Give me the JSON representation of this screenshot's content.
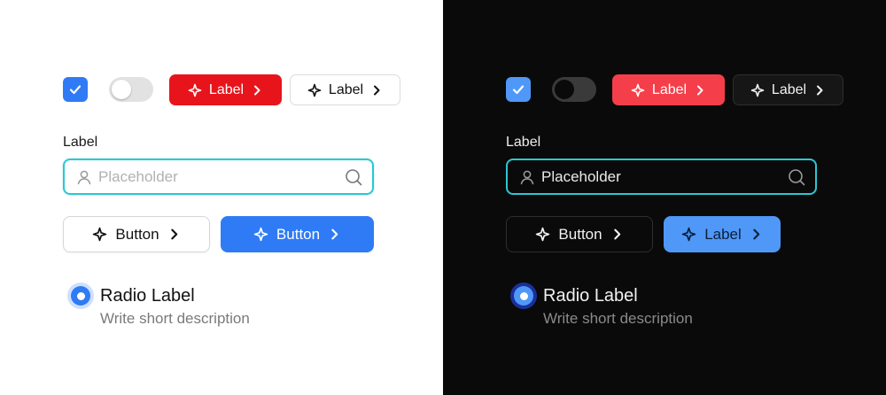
{
  "colors": {
    "primary_light": "#2f7bf5",
    "primary_dark": "#4f98f8",
    "danger_light": "#e8141c",
    "danger_dark": "#f43f4a",
    "focus_ring": "#2cc7d3"
  },
  "light": {
    "checkbox": {
      "checked": true,
      "icon": "check-icon"
    },
    "toggle": {
      "on": false
    },
    "pill_red": {
      "label": "Label",
      "icon_left": "sparkle-icon",
      "icon_right": "chevron-right-icon"
    },
    "pill_plain": {
      "label": "Label",
      "icon_left": "sparkle-icon",
      "icon_right": "chevron-right-icon"
    },
    "field_label": "Label",
    "search": {
      "placeholder": "Placeholder",
      "icon_left": "user-icon",
      "icon_right": "search-icon"
    },
    "button_outline": {
      "label": "Button"
    },
    "button_primary": {
      "label": "Button"
    },
    "radio": {
      "selected": true,
      "label": "Radio Label",
      "description": "Write short description"
    }
  },
  "dark": {
    "checkbox": {
      "checked": true,
      "icon": "check-icon"
    },
    "toggle": {
      "on": false
    },
    "pill_red": {
      "label": "Label",
      "icon_left": "sparkle-icon",
      "icon_right": "chevron-right-icon"
    },
    "pill_plain": {
      "label": "Label",
      "icon_left": "sparkle-icon",
      "icon_right": "chevron-right-icon"
    },
    "field_label": "Label",
    "search": {
      "placeholder": "Placeholder",
      "icon_left": "user-icon",
      "icon_right": "search-icon"
    },
    "button_outline": {
      "label": "Button"
    },
    "button_primary": {
      "label": "Label"
    },
    "radio": {
      "selected": true,
      "label": "Radio Label",
      "description": "Write short description"
    }
  }
}
